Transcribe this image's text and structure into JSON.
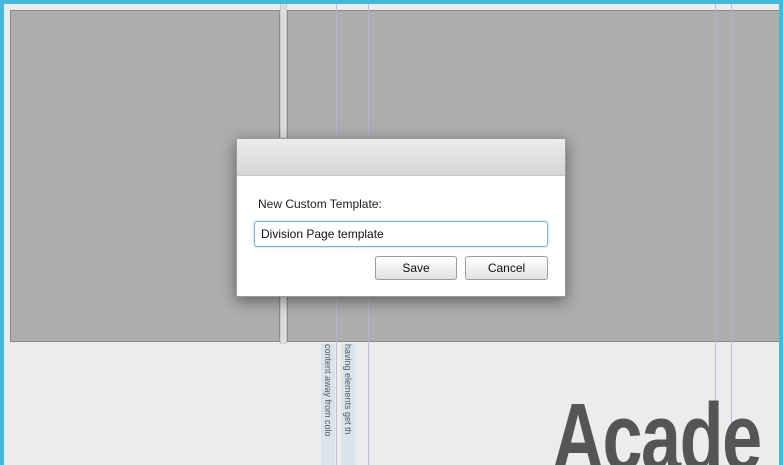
{
  "background": {
    "vertical_text_1": "content away from colo",
    "vertical_text_2": "having elements get th",
    "heading_text": "Acade"
  },
  "dialog": {
    "label": "New Custom Template:",
    "input_value": "Division Page template",
    "save_label": "Save",
    "cancel_label": "Cancel"
  },
  "colors": {
    "frame_border": "#45b8dd",
    "panel_fill": "#adadad",
    "input_focus": "#7fb2e0"
  }
}
